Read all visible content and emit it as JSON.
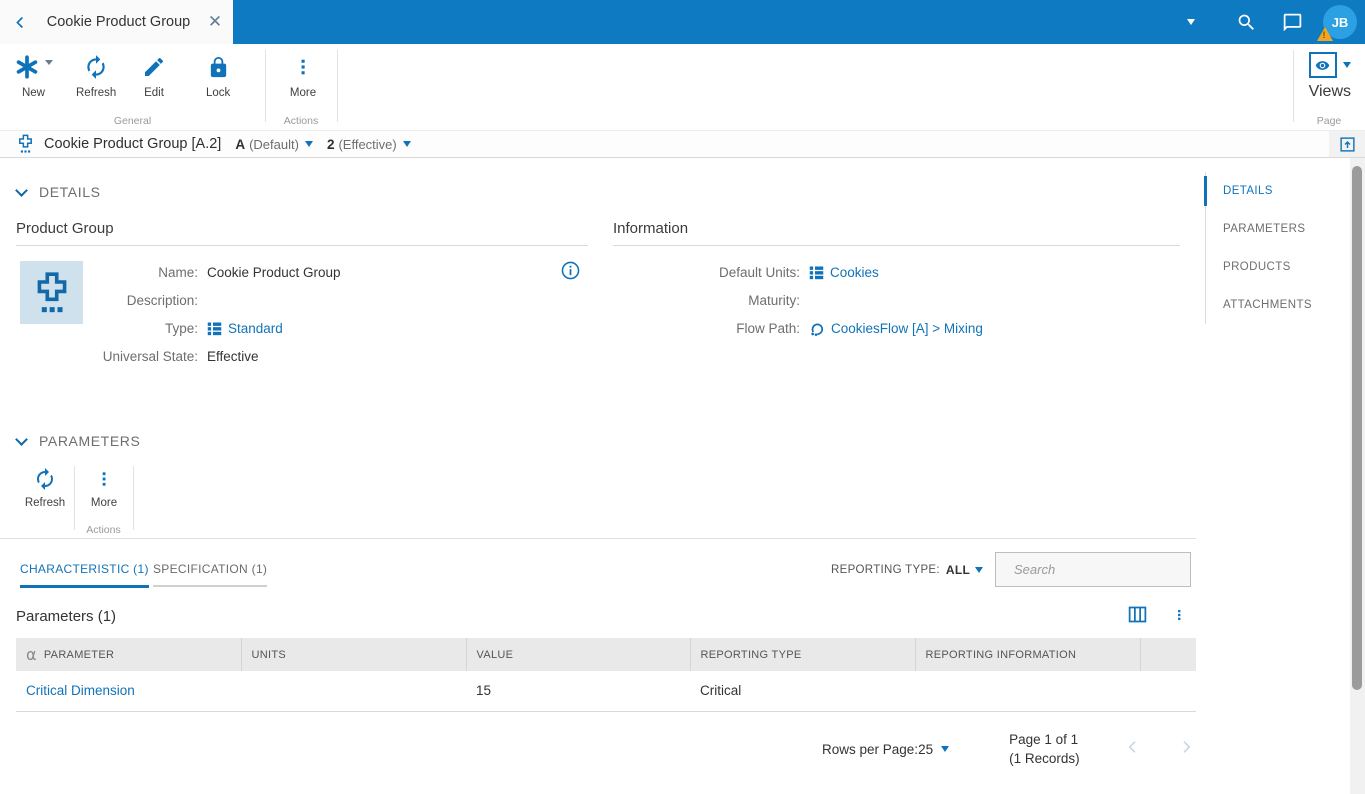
{
  "colors": {
    "accent": "#0d7ac2",
    "link": "#1173b8",
    "active_nav": "#1073ba",
    "warning_badge": "#f2a51f",
    "avatar_bg": "#2ba0e3"
  },
  "titlebar": {
    "tab_title": "Cookie Product Group",
    "avatar_initials": "JB"
  },
  "ribbon": {
    "new_label": "New",
    "refresh_label": "Refresh",
    "edit_label": "Edit",
    "lock_label": "Lock",
    "more_label": "More",
    "group_general": "General",
    "group_actions": "Actions",
    "views_label": "Views",
    "group_page": "Page"
  },
  "breadcrumb": {
    "title": "Cookie Product Group [A.2]",
    "version_letter": "A",
    "version_state": "(Default)",
    "revision_number": "2",
    "revision_state": "(Effective)"
  },
  "details": {
    "section_title": "DETAILS",
    "product_group": {
      "heading": "Product Group",
      "name_label": "Name:",
      "name_value": "Cookie Product Group",
      "description_label": "Description:",
      "description_value": "",
      "type_label": "Type:",
      "type_value": "Standard",
      "state_label": "Universal State:",
      "state_value": "Effective"
    },
    "information": {
      "heading": "Information",
      "units_label": "Default Units:",
      "units_value": "Cookies",
      "maturity_label": "Maturity:",
      "maturity_value": "",
      "flow_label": "Flow Path:",
      "flow_value": "CookiesFlow [A] > Mixing"
    }
  },
  "sidebar": {
    "items": [
      "DETAILS",
      "PARAMETERS",
      "PRODUCTS",
      "ATTACHMENTS"
    ]
  },
  "parameters": {
    "section_title": "PARAMETERS",
    "toolbar": {
      "refresh_label": "Refresh",
      "more_label": "More",
      "group_actions": "Actions"
    },
    "tabs": {
      "characteristic": "CHARACTERISTIC (1)",
      "specification": "SPECIFICATION (1)"
    },
    "reporting_type_label": "REPORTING TYPE:",
    "reporting_type_value": "ALL",
    "search_placeholder": "Search",
    "table": {
      "title": "Parameters (1)",
      "columns": [
        "PARAMETER",
        "UNITS",
        "VALUE",
        "REPORTING TYPE",
        "REPORTING INFORMATION"
      ],
      "row": {
        "parameter": "Critical Dimension",
        "units": "",
        "value": "15",
        "reporting_type": "Critical",
        "reporting_information": ""
      }
    },
    "footer": {
      "rows_label": "Rows per Page:",
      "rows_value": "25",
      "page_info": "Page 1 of 1",
      "records_info": "(1 Records)"
    }
  }
}
